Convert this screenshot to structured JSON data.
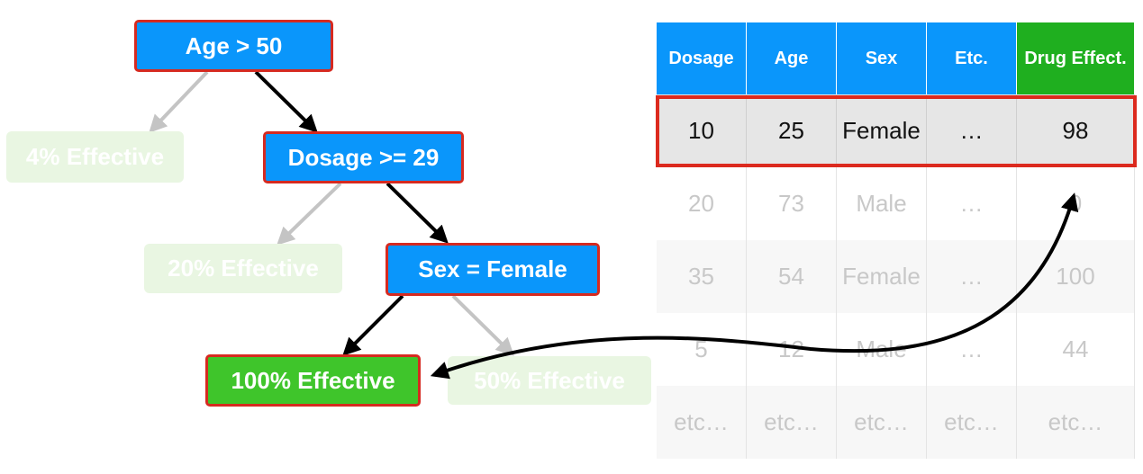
{
  "tree": {
    "nodes": [
      {
        "id": "age",
        "label": "Age > 50",
        "style": "decision"
      },
      {
        "id": "eff4",
        "label": "4% Effective",
        "style": "faded-leaf"
      },
      {
        "id": "dosage",
        "label": "Dosage >= 29",
        "style": "decision"
      },
      {
        "id": "eff20",
        "label": "20% Effective",
        "style": "faded-leaf"
      },
      {
        "id": "sex",
        "label": "Sex = Female",
        "style": "decision"
      },
      {
        "id": "eff100",
        "label": "100% Effective",
        "style": "selected-leaf"
      },
      {
        "id": "eff50",
        "label": "50% Effective",
        "style": "faded-leaf"
      }
    ],
    "edges": [
      {
        "from": "age",
        "to": "eff4",
        "active": false
      },
      {
        "from": "age",
        "to": "dosage",
        "active": true
      },
      {
        "from": "dosage",
        "to": "eff20",
        "active": false
      },
      {
        "from": "dosage",
        "to": "sex",
        "active": true
      },
      {
        "from": "sex",
        "to": "eff100",
        "active": true
      },
      {
        "from": "sex",
        "to": "eff50",
        "active": false
      }
    ]
  },
  "table": {
    "headers": [
      "Dosage",
      "Age",
      "Sex",
      "Etc.",
      "Drug Effect."
    ],
    "rows": [
      [
        "10",
        "25",
        "Female",
        "…",
        "98"
      ],
      [
        "20",
        "73",
        "Male",
        "…",
        "0"
      ],
      [
        "35",
        "54",
        "Female",
        "…",
        "100"
      ],
      [
        "5",
        "12",
        "Male",
        "…",
        "44"
      ],
      [
        "etc…",
        "etc…",
        "etc…",
        "etc…",
        "etc…"
      ]
    ],
    "highlighted_row": 0
  },
  "colors": {
    "decision_fill": "#0a96fb",
    "selected_leaf_fill": "#3fc52b",
    "faded_leaf_fill": "#e9f6e2",
    "highlight_border": "#dc2a1e",
    "effect_header_fill": "#1faf1f",
    "active_edge": "#000000",
    "inactive_edge": "#c4c4c4"
  }
}
